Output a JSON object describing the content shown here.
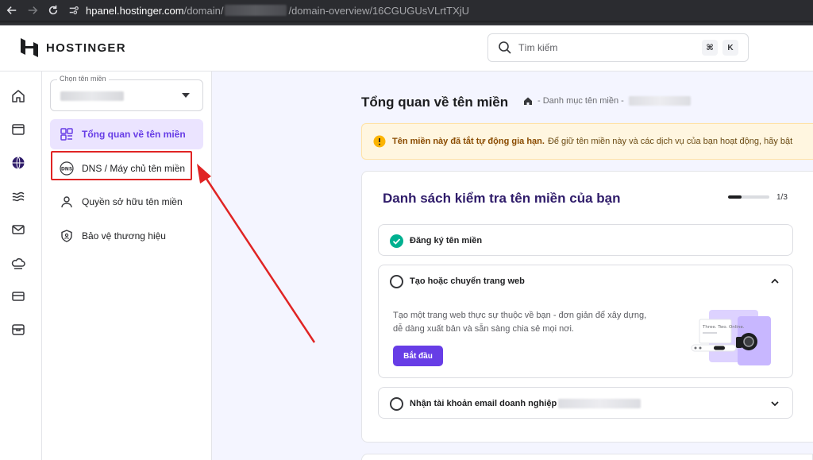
{
  "browser": {
    "url_host": "hpanel.hostinger.com",
    "url_path_prefix": "/domain/",
    "url_path_suffix": "/domain-overview/16CGUGUsVLrtTXjU"
  },
  "header": {
    "logo_text": "HOSTINGER",
    "search_placeholder": "Tìm kiếm",
    "shortcut_key1": "⌘",
    "shortcut_key2": "K"
  },
  "rail": {
    "icons": [
      "home-icon",
      "website-icon",
      "domain-globe-icon",
      "hosting-icon",
      "email-icon",
      "cloud-icon",
      "billing-icon",
      "store-icon"
    ]
  },
  "sidebar": {
    "select_label": "Chọn tên miền",
    "items": [
      {
        "label": "Tổng quan về tên miền",
        "icon": "overview-grid-icon",
        "active": true
      },
      {
        "label": "DNS / Máy chủ tên miền",
        "icon": "dns-icon",
        "active": false
      },
      {
        "label": "Quyền sở hữu tên miền",
        "icon": "person-icon",
        "active": false
      },
      {
        "label": "Bảo vệ thương hiệu",
        "icon": "shield-icon",
        "active": false
      }
    ]
  },
  "main": {
    "title": "Tổng quan về tên miền",
    "breadcrumb_text": "- Danh mục tên miền -",
    "alert_strong": "Tên miền này đã tắt tự động gia hạn.",
    "alert_text": "Để giữ tên miền này và các dịch vụ của bạn hoạt động, hãy bật",
    "checklist": {
      "title": "Danh sách kiểm tra tên miền của bạn",
      "progress_text": "1/3",
      "progress_fraction": 0.33,
      "steps": [
        {
          "label": "Đăng ký tên miền",
          "done": true
        },
        {
          "label": "Tạo hoặc chuyển trang web",
          "done": false,
          "description": "Tạo một trang web thực sự thuộc về bạn - đơn giản để xây dựng, dễ dàng xuất bản và sẵn sàng chia sẻ mọi nơi.",
          "button": "Bắt đầu",
          "illus_text": "Three. Two. Online."
        },
        {
          "label": "Nhận tài khoản email doanh nghiệp",
          "done": false
        }
      ]
    }
  },
  "colors": {
    "accent": "#673de6",
    "active_bg": "#ebe4ff",
    "highlight_red": "#e02424",
    "success_green": "#00b090",
    "alert_bg": "#fff6e0"
  }
}
